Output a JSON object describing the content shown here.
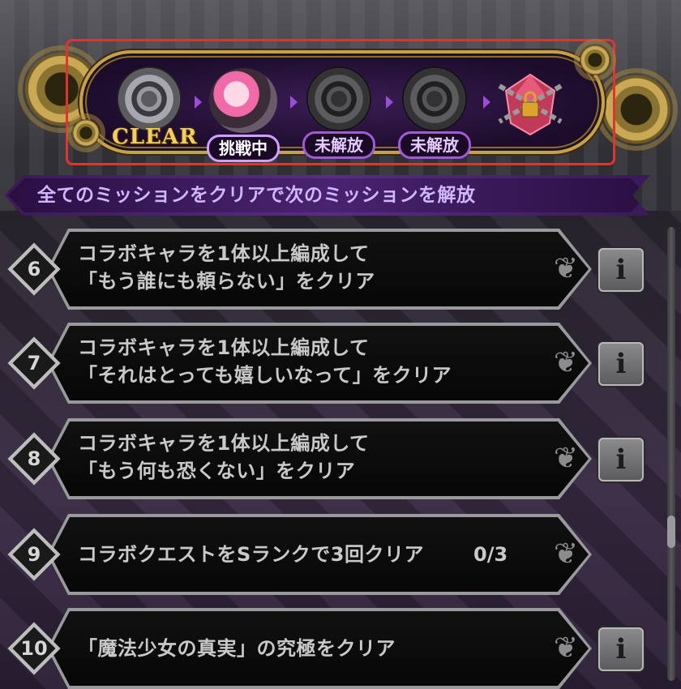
{
  "stages": [
    {
      "label": "CLEAR",
      "state": "cleared"
    },
    {
      "label": "挑戦中",
      "state": "active"
    },
    {
      "label": "未解放",
      "state": "locked"
    },
    {
      "label": "未解放",
      "state": "locked"
    }
  ],
  "notice": "全てのミッションをクリアで次のミッションを解放",
  "missions": [
    {
      "number": "6",
      "line1": "コラボキャラを1体以上編成して",
      "line2": "「もう誰にも頼らない」をクリア",
      "has_info": true
    },
    {
      "number": "7",
      "line1": "コラボキャラを1体以上編成して",
      "line2": "「それはとっても嬉しいなって」をクリア",
      "has_info": true
    },
    {
      "number": "8",
      "line1": "コラボキャラを1体以上編成して",
      "line2": "「もう何も恐くない」をクリア",
      "has_info": true
    },
    {
      "number": "9",
      "line1": "コラボクエストをSランクで3回クリア",
      "progress": "0/3",
      "has_info": false
    },
    {
      "number": "10",
      "line1": "「魔法少女の真実」の究極をクリア",
      "has_info": true
    }
  ],
  "icons": {
    "info": "info-icon",
    "ornament": "scroll-ornament-icon",
    "reward": "locked-gem-icon"
  },
  "colors": {
    "highlight": "#e2332f",
    "accent_purple": "#5a2c86",
    "gold": "#c9a04a"
  }
}
